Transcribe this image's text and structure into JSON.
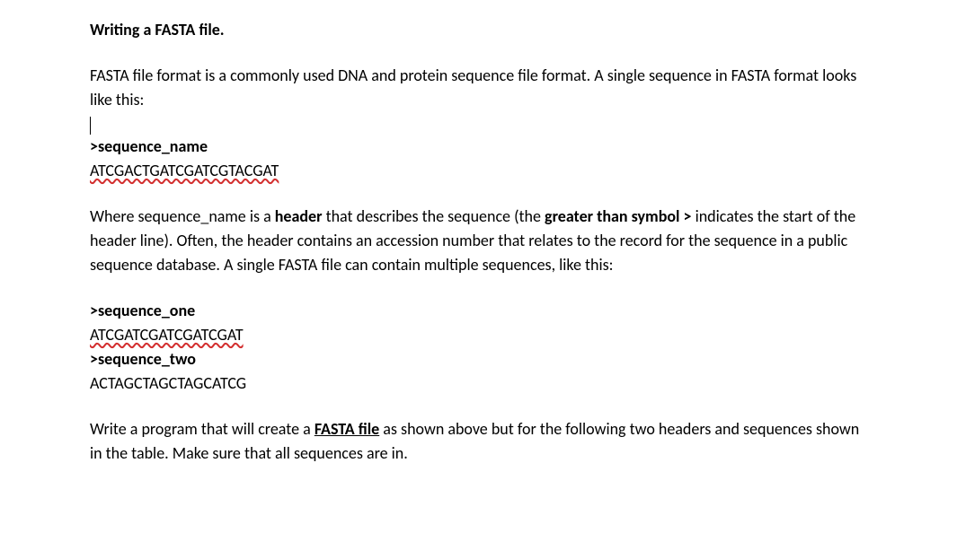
{
  "title": "Writing a FASTA file.",
  "intro_part1": "FASTA file format is a commonly used DNA and protein sequence file format. A single sequence in FASTA format looks like this:",
  "example1": {
    "header": ">sequence_name",
    "sequence": "ATCGACTGATCGATCGTACGAT"
  },
  "middle_p1_before": "Where sequence_name is a ",
  "middle_p1_bold1": "header",
  "middle_p1_mid1": " that describes the sequence (the ",
  "middle_p1_bold2": "greater than symbol >",
  "middle_p1_after": " indicates the start of the header line). Often, the header contains an accession number that relates to the record for the sequence in a public sequence database. A single FASTA file can contain multiple sequences, like this:",
  "example2": {
    "header1": ">sequence_one",
    "sequence1": "ATCGATCGATCGATCGAT",
    "header2": ">sequence_two",
    "sequence2": "ACTAGCTAGCTAGCATCG"
  },
  "final_before": "Write a program that will create a ",
  "final_bold": "FASTA file",
  "final_after": " as shown above but for the following two headers and sequences shown in the table. Make sure that all sequences are in."
}
